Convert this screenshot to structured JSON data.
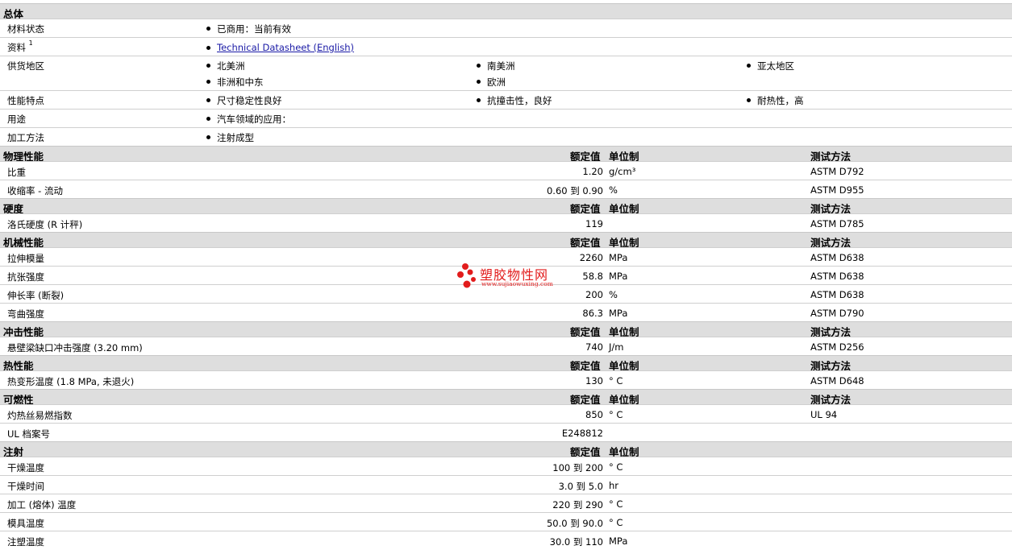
{
  "general": {
    "title": "总体",
    "material_status": {
      "label": "材料状态",
      "value": "已商用：当前有效"
    },
    "documents": {
      "label": "资料",
      "sup": "1",
      "link": "Technical Datasheet (English)"
    },
    "supply": {
      "label": "供货地区",
      "items": [
        "北美洲",
        "南美洲",
        "亚太地区",
        "非洲和中东",
        "欧洲"
      ]
    },
    "features": {
      "label": "性能特点",
      "items": [
        "尺寸稳定性良好",
        "抗撞击性，良好",
        "耐热性，高"
      ]
    },
    "uses": {
      "label": "用途",
      "value": "汽车领域的应用："
    },
    "processing": {
      "label": "加工方法",
      "value": "注射成型"
    }
  },
  "columns": {
    "nominal": "额定值",
    "unit": "单位制",
    "method": "测试方法"
  },
  "sections": [
    {
      "title": "物理性能",
      "show_method": true,
      "rows": [
        {
          "name": "比重",
          "value": "1.20",
          "unit": "g/cm³",
          "method": "ASTM D792"
        },
        {
          "name": "收缩率 - 流动",
          "value": "0.60 到 0.90",
          "unit": "%",
          "method": "ASTM D955"
        }
      ]
    },
    {
      "title": "硬度",
      "show_method": true,
      "rows": [
        {
          "name": "洛氏硬度 (R 计秤)",
          "value": "119",
          "unit": "",
          "method": "ASTM D785"
        }
      ]
    },
    {
      "title": "机械性能",
      "show_method": true,
      "rows": [
        {
          "name": "拉伸模量",
          "value": "2260",
          "unit": "MPa",
          "method": "ASTM D638"
        },
        {
          "name": "抗张强度",
          "value": "58.8",
          "unit": "MPa",
          "method": "ASTM D638"
        },
        {
          "name": "伸长率 (断裂)",
          "value": "200",
          "unit": "%",
          "method": "ASTM D638"
        },
        {
          "name": "弯曲强度",
          "value": "86.3",
          "unit": "MPa",
          "method": "ASTM D790"
        }
      ]
    },
    {
      "title": "冲击性能",
      "show_method": true,
      "rows": [
        {
          "name": "悬壁梁缺口冲击强度 (3.20 mm)",
          "value": "740",
          "unit": "J/m",
          "method": "ASTM D256"
        }
      ]
    },
    {
      "title": "热性能",
      "show_method": true,
      "rows": [
        {
          "name": "热变形温度 (1.8 MPa, 未退火)",
          "value": "130",
          "unit": "° C",
          "method": "ASTM D648"
        }
      ]
    },
    {
      "title": "可燃性",
      "show_method": true,
      "rows": [
        {
          "name": "灼热丝易燃指数",
          "value": "850",
          "unit": "° C",
          "method": "UL 94"
        },
        {
          "name": "UL 档案号",
          "value": "E248812",
          "unit": "",
          "method": ""
        }
      ]
    },
    {
      "title": "注射",
      "show_method": false,
      "rows": [
        {
          "name": "干燥温度",
          "value": "100 到 200",
          "unit": "° C",
          "method": ""
        },
        {
          "name": "干燥时间",
          "value": "3.0 到 5.0",
          "unit": "hr",
          "method": ""
        },
        {
          "name": "加工 (熔体) 温度",
          "value": "220 到 290",
          "unit": "° C",
          "method": ""
        },
        {
          "name": "模具温度",
          "value": "50.0 到 90.0",
          "unit": "° C",
          "method": ""
        },
        {
          "name": "注塑温度",
          "value": "30.0 到 110",
          "unit": "MPa",
          "method": ""
        }
      ]
    }
  ],
  "watermark": {
    "text": "塑胶物性网",
    "url": "www.sujiaowuxing.com",
    "color": "#e21c1c"
  }
}
